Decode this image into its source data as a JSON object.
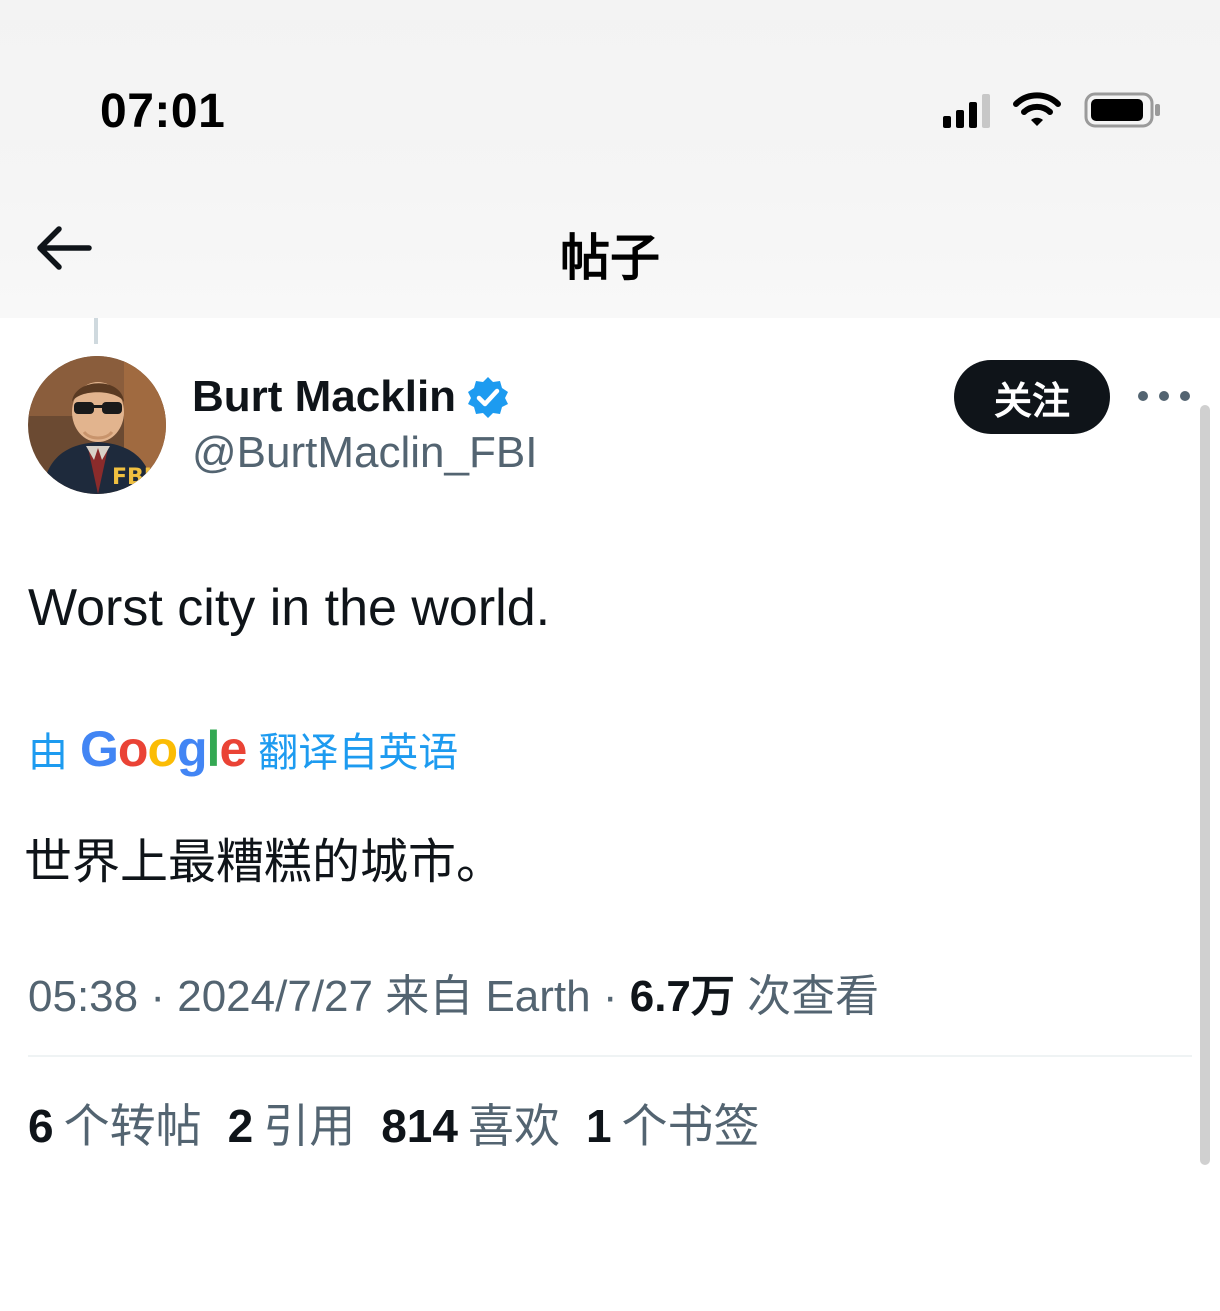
{
  "status_bar": {
    "time": "07:01",
    "icons": [
      "signal-icon",
      "wifi-icon",
      "battery-icon"
    ]
  },
  "header": {
    "title": "帖子",
    "back_icon": "arrow-left-icon"
  },
  "author": {
    "name": "Burt Macklin",
    "handle": "@BurtMaclin_FBI",
    "verified_icon": "verified-badge-icon",
    "avatar_text": "FBI"
  },
  "actions": {
    "follow_label": "关注",
    "more_icon": "more-horizontal-icon"
  },
  "tweet": {
    "text": "Worst city in the world.",
    "translate_prefix": "由",
    "translate_suffix": "翻译自英语",
    "translated_text": "世界上最糟糕的城市。"
  },
  "meta": {
    "time": "05:38",
    "sep1": "·",
    "date": "2024/7/27",
    "from": "来自 Earth",
    "sep2": "·",
    "views_count": "6.7万",
    "views_label": "次查看"
  },
  "stats": {
    "reposts_count": "6",
    "reposts_label": "个转帖",
    "quotes_count": "2",
    "quotes_label": "引用",
    "likes_count": "814",
    "likes_label": "喜欢",
    "bookmarks_count": "1",
    "bookmarks_label": "个书签"
  },
  "colors": {
    "accent": "#1d9bf0",
    "text_primary": "#0f1419",
    "text_secondary": "#536471",
    "follow_bg": "#0f1419"
  }
}
